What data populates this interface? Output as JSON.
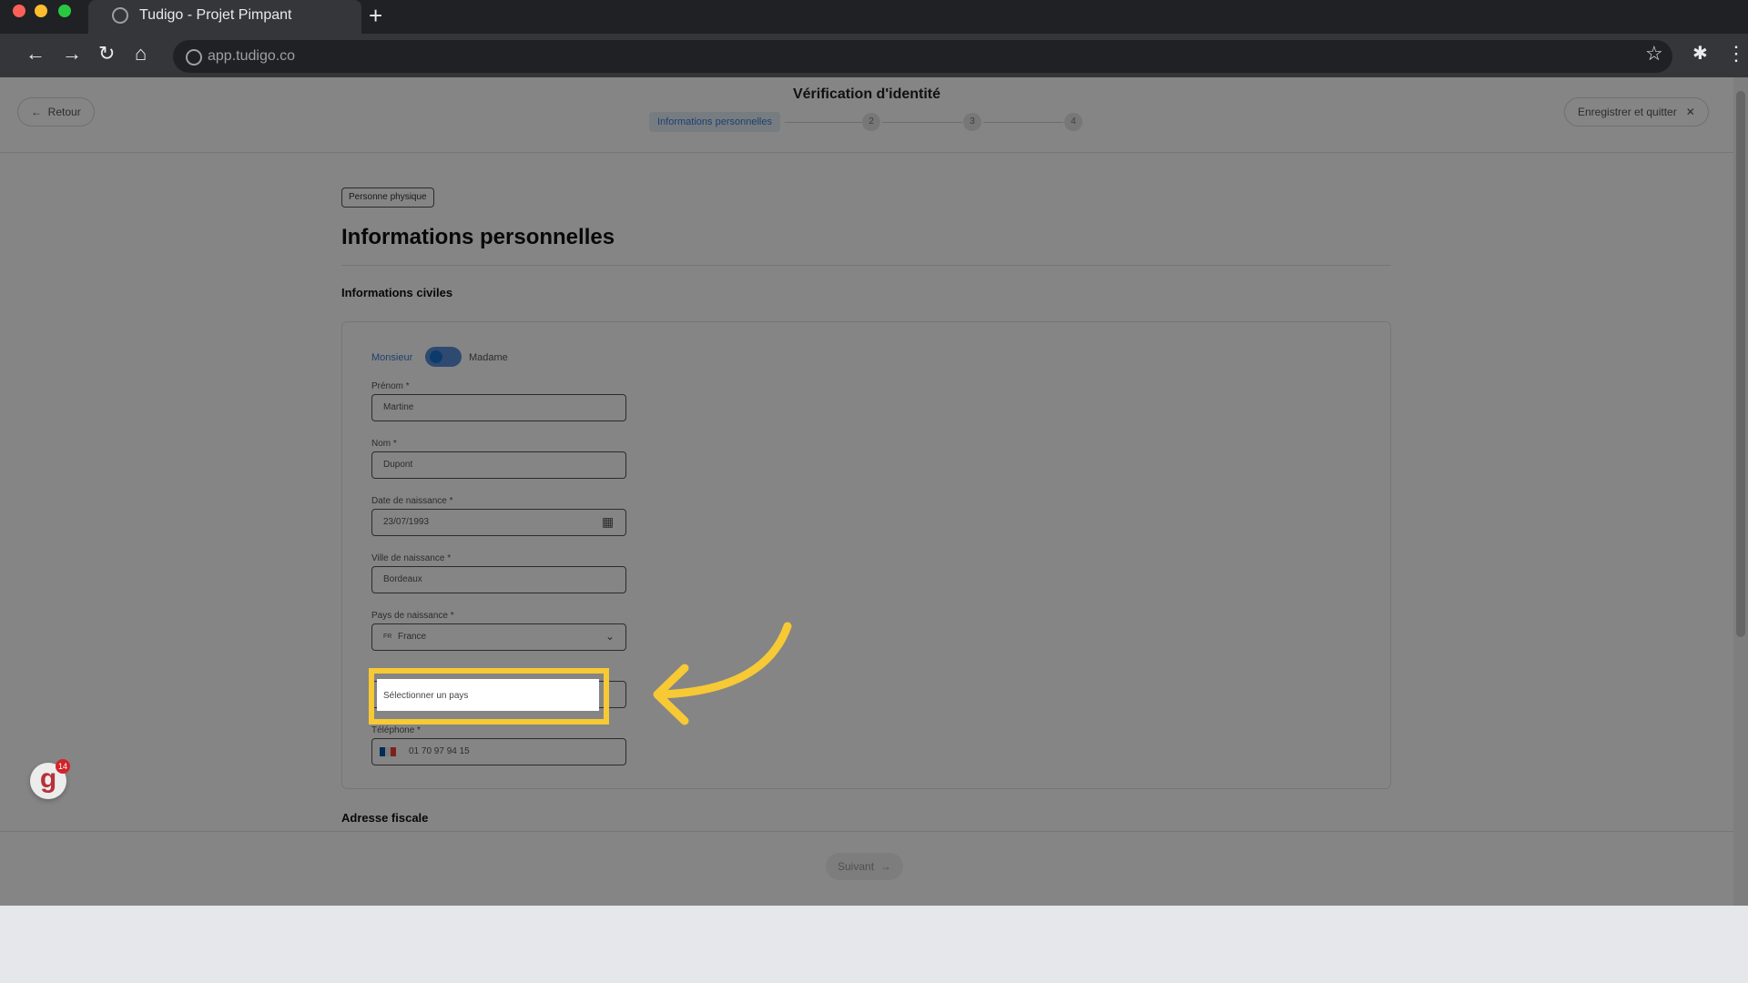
{
  "browser": {
    "tab_title": "Tudigo - Projet Pimpant",
    "url": "app.tudigo.co"
  },
  "header": {
    "back_label": "Retour",
    "title": "Vérification d'identité",
    "steps": [
      "Informations personnelles",
      "2",
      "3",
      "4"
    ],
    "save_label": "Enregistrer et quitter"
  },
  "main": {
    "badge": "Personne physique",
    "title": "Informations personnelles",
    "section_civil": "Informations civiles",
    "gender": {
      "option_1": "Monsieur",
      "option_2": "Madame"
    },
    "fields": {
      "prenom": {
        "label": "Prénom *",
        "value": "Martine"
      },
      "nom": {
        "label": "Nom *",
        "value": "Dupont"
      },
      "dob": {
        "label": "Date de naissance *",
        "value": "23/07/1993"
      },
      "birth_city": {
        "label": "Ville de naissance *",
        "value": "Bordeaux"
      },
      "birth_country": {
        "label": "Pays de naissance *",
        "value": "France"
      },
      "nationality": {
        "placeholder": "Sélectionner un pays"
      },
      "phone": {
        "label": "Téléphone *",
        "value": "01 70 97 94 15"
      }
    },
    "section_address": "Adresse fiscale"
  },
  "footer": {
    "next_label": "Suivant",
    "notification_count": "14"
  },
  "colors": {
    "accent": "#3a7bd5",
    "highlight": "#f6c935",
    "brand_red": "#c0232c"
  }
}
